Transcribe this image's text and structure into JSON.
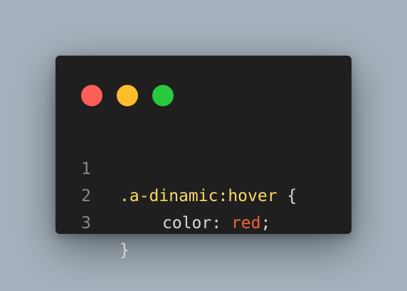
{
  "colors": {
    "background": "#a5b1bc",
    "window": "#1f1f1f",
    "dot_red": "#ff5f56",
    "dot_yellow": "#ffbd2e",
    "dot_green": "#27c93f",
    "line_number": "#8a8a8a",
    "selector": "#ffd866",
    "property": "#d8d8d8",
    "value": "#f0643c",
    "punctuation": "#d8d8d8"
  },
  "window_controls": [
    "close",
    "minimize",
    "maximize"
  ],
  "code": {
    "lines": [
      {
        "number": "1",
        "selector": ".a-dinamic:hover",
        "brace_open": " {"
      },
      {
        "number": "2",
        "property": "color",
        "colon": ": ",
        "value": "red",
        "semicolon": ";"
      },
      {
        "number": "3",
        "brace_close": "}"
      }
    ]
  }
}
